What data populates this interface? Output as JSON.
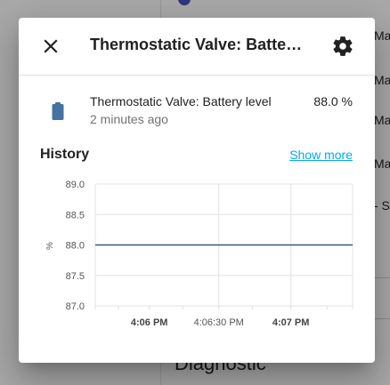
{
  "background": {
    "side_items": [
      "Ma",
      "Ma",
      "Ma",
      "Ma",
      "- S"
    ],
    "heading": "Diagnostic"
  },
  "dialog": {
    "title": "Thermostatic Valve: Battery level",
    "close_icon": "close-icon",
    "settings_icon": "gear-icon"
  },
  "entity": {
    "icon": "battery-icon",
    "name": "Thermostatic Valve: Battery level",
    "last_changed": "2 minutes ago",
    "state": "88.0 %"
  },
  "history": {
    "label": "History",
    "show_more": "Show more"
  },
  "colors": {
    "accent": "#03a9f4",
    "icon": "#44739e",
    "line": "#2e5a80"
  },
  "chart_data": {
    "type": "line",
    "ylabel": "%",
    "ylim": [
      87.0,
      89.0
    ],
    "y_ticks": [
      "89.0",
      "88.5",
      "88.0",
      "87.5",
      "87.0"
    ],
    "x_ticks": [
      {
        "label": "4:06 PM",
        "bold": true
      },
      {
        "label": "4:06:30 PM",
        "bold": false
      },
      {
        "label": "4:07 PM",
        "bold": true
      }
    ],
    "series": [
      {
        "x": [
          "4:05:40 PM",
          "4:07:40 PM"
        ],
        "values": [
          88.0,
          88.0
        ]
      }
    ],
    "grid": true
  }
}
